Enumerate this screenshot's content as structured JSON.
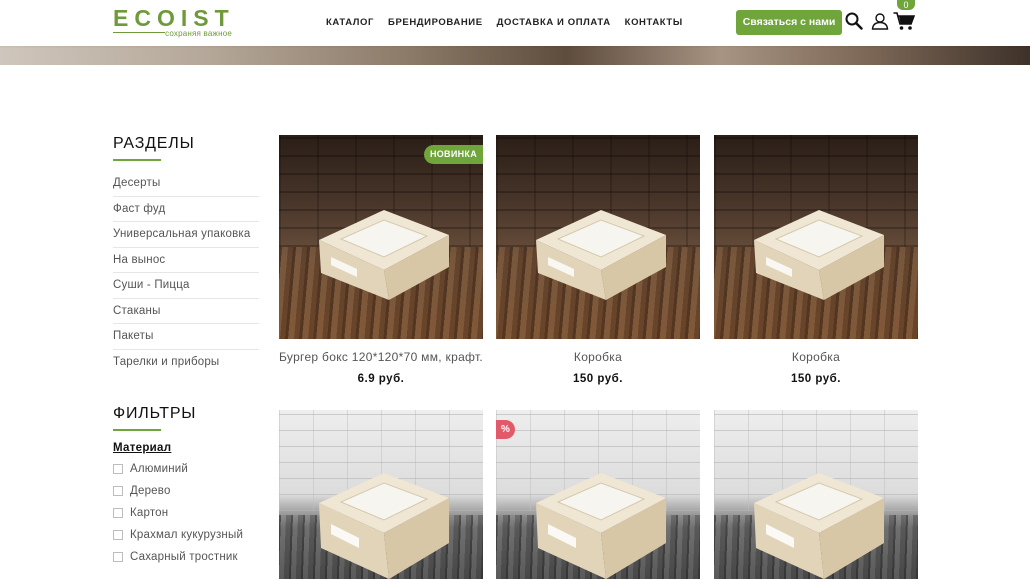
{
  "header": {
    "logo_main": "ECOIST",
    "logo_sub": "сохраняя важное",
    "nav": [
      "КАТАЛОГ",
      "БРЕНДИРОВАНИЕ",
      "ДОСТАВКА И ОПЛАТА",
      "КОНТАКТЫ"
    ],
    "contact_button": "Связаться с нами",
    "cart_count": "0",
    "icons": [
      "search-icon",
      "user-icon",
      "cart-icon"
    ]
  },
  "sidebar": {
    "sections_title": "РАЗДЕЛЫ",
    "categories": [
      "Десерты",
      "Фаст фуд",
      "Универсальная упаковка",
      "На вынос",
      "Суши - Пицца",
      "Стаканы",
      "Пакеты",
      "Тарелки и приборы"
    ],
    "filters_title": "ФИЛЬТРЫ",
    "filter_group": "Материал",
    "materials": [
      "Алюминий",
      "Дерево",
      "Картон",
      "Крахмал кукурузный",
      "Сахарный тростник"
    ]
  },
  "products": [
    {
      "name": "Бургер бокс 120*120*70 мм, крафт.",
      "price": "6.9 руб.",
      "badge": "НОВИНКА"
    },
    {
      "name": "Коробка",
      "price": "150 руб.",
      "badge": ""
    },
    {
      "name": "Коробка",
      "price": "150 руб.",
      "badge": ""
    },
    {
      "name": "",
      "price": "",
      "badge": ""
    },
    {
      "name": "",
      "price": "",
      "badge": "%"
    },
    {
      "name": "",
      "price": "",
      "badge": ""
    }
  ],
  "colors": {
    "accent": "#6fa53a",
    "sale": "#e25a6a",
    "text": "#333333"
  }
}
